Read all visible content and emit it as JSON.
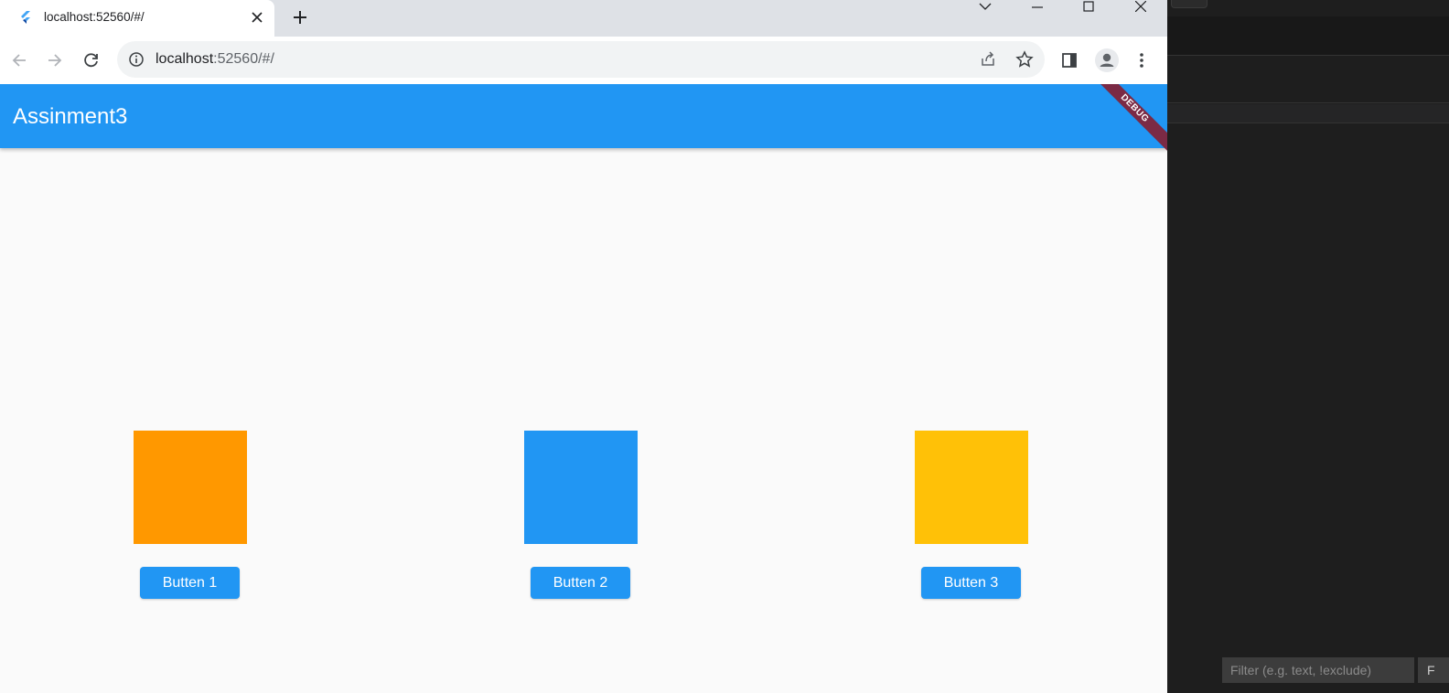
{
  "browser": {
    "tab": {
      "title": "localhost:52560/#/",
      "favicon": "flutter-icon",
      "close_icon": "close-icon"
    },
    "new_tab_icon": "plus-icon",
    "window_controls": [
      "chevron-down-icon",
      "minimize-icon",
      "maximize-icon",
      "close-icon"
    ],
    "nav": {
      "back": "back-arrow-icon",
      "forward": "forward-arrow-icon",
      "reload": "reload-icon"
    },
    "address": {
      "host": "localhost",
      "rest": ":52560/#/"
    },
    "omnibox_icons": [
      "info-icon",
      "share-icon",
      "star-icon"
    ],
    "toolbar_icons": [
      "side-panel-icon",
      "profile-icon",
      "more-vert-icon"
    ]
  },
  "app": {
    "title": "Assinment3",
    "debug_banner": "DEBUG",
    "colors": {
      "primary": "#2196f3",
      "orange": "#ff9800",
      "blue": "#2196f3",
      "amber": "#ffc107",
      "background": "#fafafa"
    },
    "buttons": [
      {
        "label": "Butten 1"
      },
      {
        "label": "Butten 2"
      },
      {
        "label": "Butten 3"
      }
    ]
  },
  "ide": {
    "filter": {
      "placeholder": "Filter (e.g. text, !exclude)",
      "value": ""
    },
    "side_button": "F"
  }
}
